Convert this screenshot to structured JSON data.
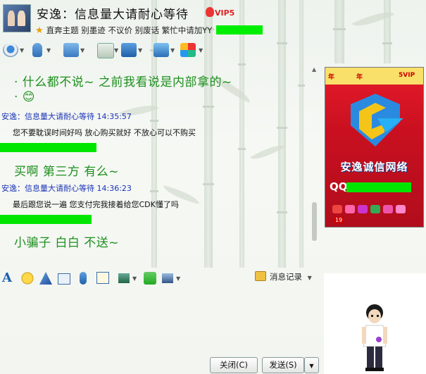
{
  "header": {
    "title": "安逸：信息量大请耐心等待",
    "vip_label": "VIP5",
    "signature": "直奔主题 别墨迹 不议价 别废话 繁忙中请加YY"
  },
  "messages": [
    {
      "kind": "big",
      "text": "· 什么都不说~ 之前我看说是内部拿的~"
    },
    {
      "kind": "big",
      "text": "· 😊"
    },
    {
      "kind": "meta",
      "text": "安逸：信息量大请耐心等待  14:35:57"
    },
    {
      "kind": "msg",
      "text": "您不要耽误时间好吗 放心购买就好  不放心可以不购买"
    },
    {
      "kind": "big",
      "text": "买啊 第三方 有么~"
    },
    {
      "kind": "meta",
      "text": "安逸：信息量大请耐心等待  14:36:23"
    },
    {
      "kind": "msg",
      "text": "最后跟您说一遍 您支付完我接着给您CDK懂了吗"
    },
    {
      "kind": "big",
      "text": "小骗子 白白 不送~"
    }
  ],
  "ad": {
    "brand": "安逸诚信网络",
    "qq_label": "QQ",
    "ribbon": [
      "年",
      "年",
      "5VIP"
    ],
    "count": "19"
  },
  "input_toolbar": {
    "history_label": "消息记录"
  },
  "footer": {
    "close_label": "关闭(C)",
    "send_label": "发送(S)"
  },
  "colors": {
    "friend_text": "#1d8f1d",
    "meta_text": "#1a33b5",
    "redaction": "#00e600",
    "ad_red": "#c91020"
  },
  "toolbar_icons": [
    "video-icon",
    "voice-icon",
    "file-transfer-icon",
    "app-icon",
    "remote-assist-icon",
    "screen-share-icon",
    "apps-grid-icon"
  ],
  "input_icons": [
    "font-icon",
    "emoji-icon",
    "magic-icon",
    "snapshot-icon",
    "voice-message-icon",
    "doodle-icon",
    "image-icon",
    "music-icon",
    "screenshot-icon"
  ]
}
